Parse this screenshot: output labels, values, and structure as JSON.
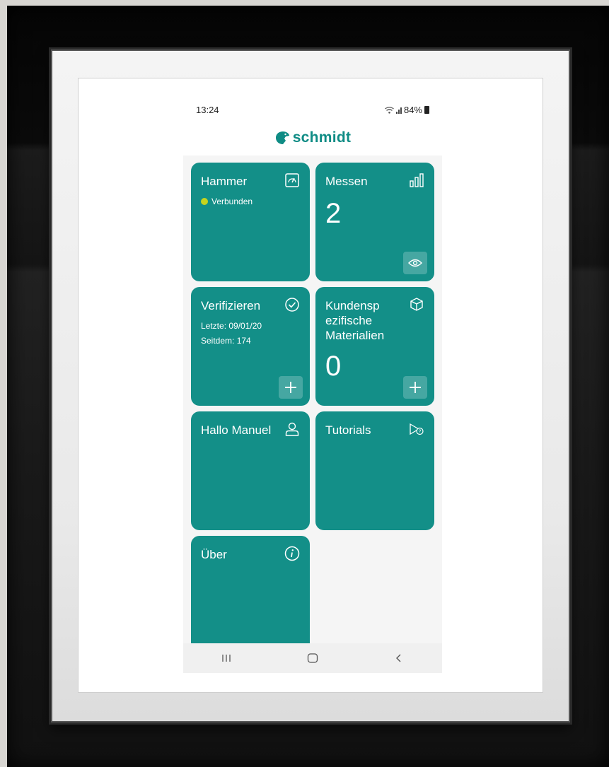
{
  "status_bar": {
    "time": "13:24",
    "battery": "84%"
  },
  "brand": {
    "name": "schmidt",
    "color": "#0f8c85"
  },
  "tiles": {
    "hammer": {
      "title": "Hammer",
      "status": "Verbunden",
      "icon": "gauge-icon"
    },
    "messen": {
      "title": "Messen",
      "count": "2",
      "icon": "bar-chart-icon",
      "action_icon": "eye-icon"
    },
    "verifizieren": {
      "title": "Verifizieren",
      "last_label": "Letzte: 09/01/20",
      "since_label": "Seitdem: 174",
      "icon": "check-circle-icon",
      "action_icon": "plus-icon"
    },
    "materialien": {
      "title_line1": "Kundensp",
      "title_line2": "ezifische",
      "title_line3": "Materialien",
      "count": "0",
      "icon": "cube-icon",
      "action_icon": "plus-icon"
    },
    "user": {
      "title": "Hallo Manuel",
      "icon": "user-icon"
    },
    "tutorials": {
      "title": "Tutorials",
      "icon": "video-help-icon"
    },
    "about": {
      "title": "Über",
      "icon": "info-icon"
    }
  },
  "nav": {
    "recents": "|||",
    "back": "<"
  },
  "colors": {
    "tile": "#138f88",
    "connected_dot": "#c6d41e"
  }
}
